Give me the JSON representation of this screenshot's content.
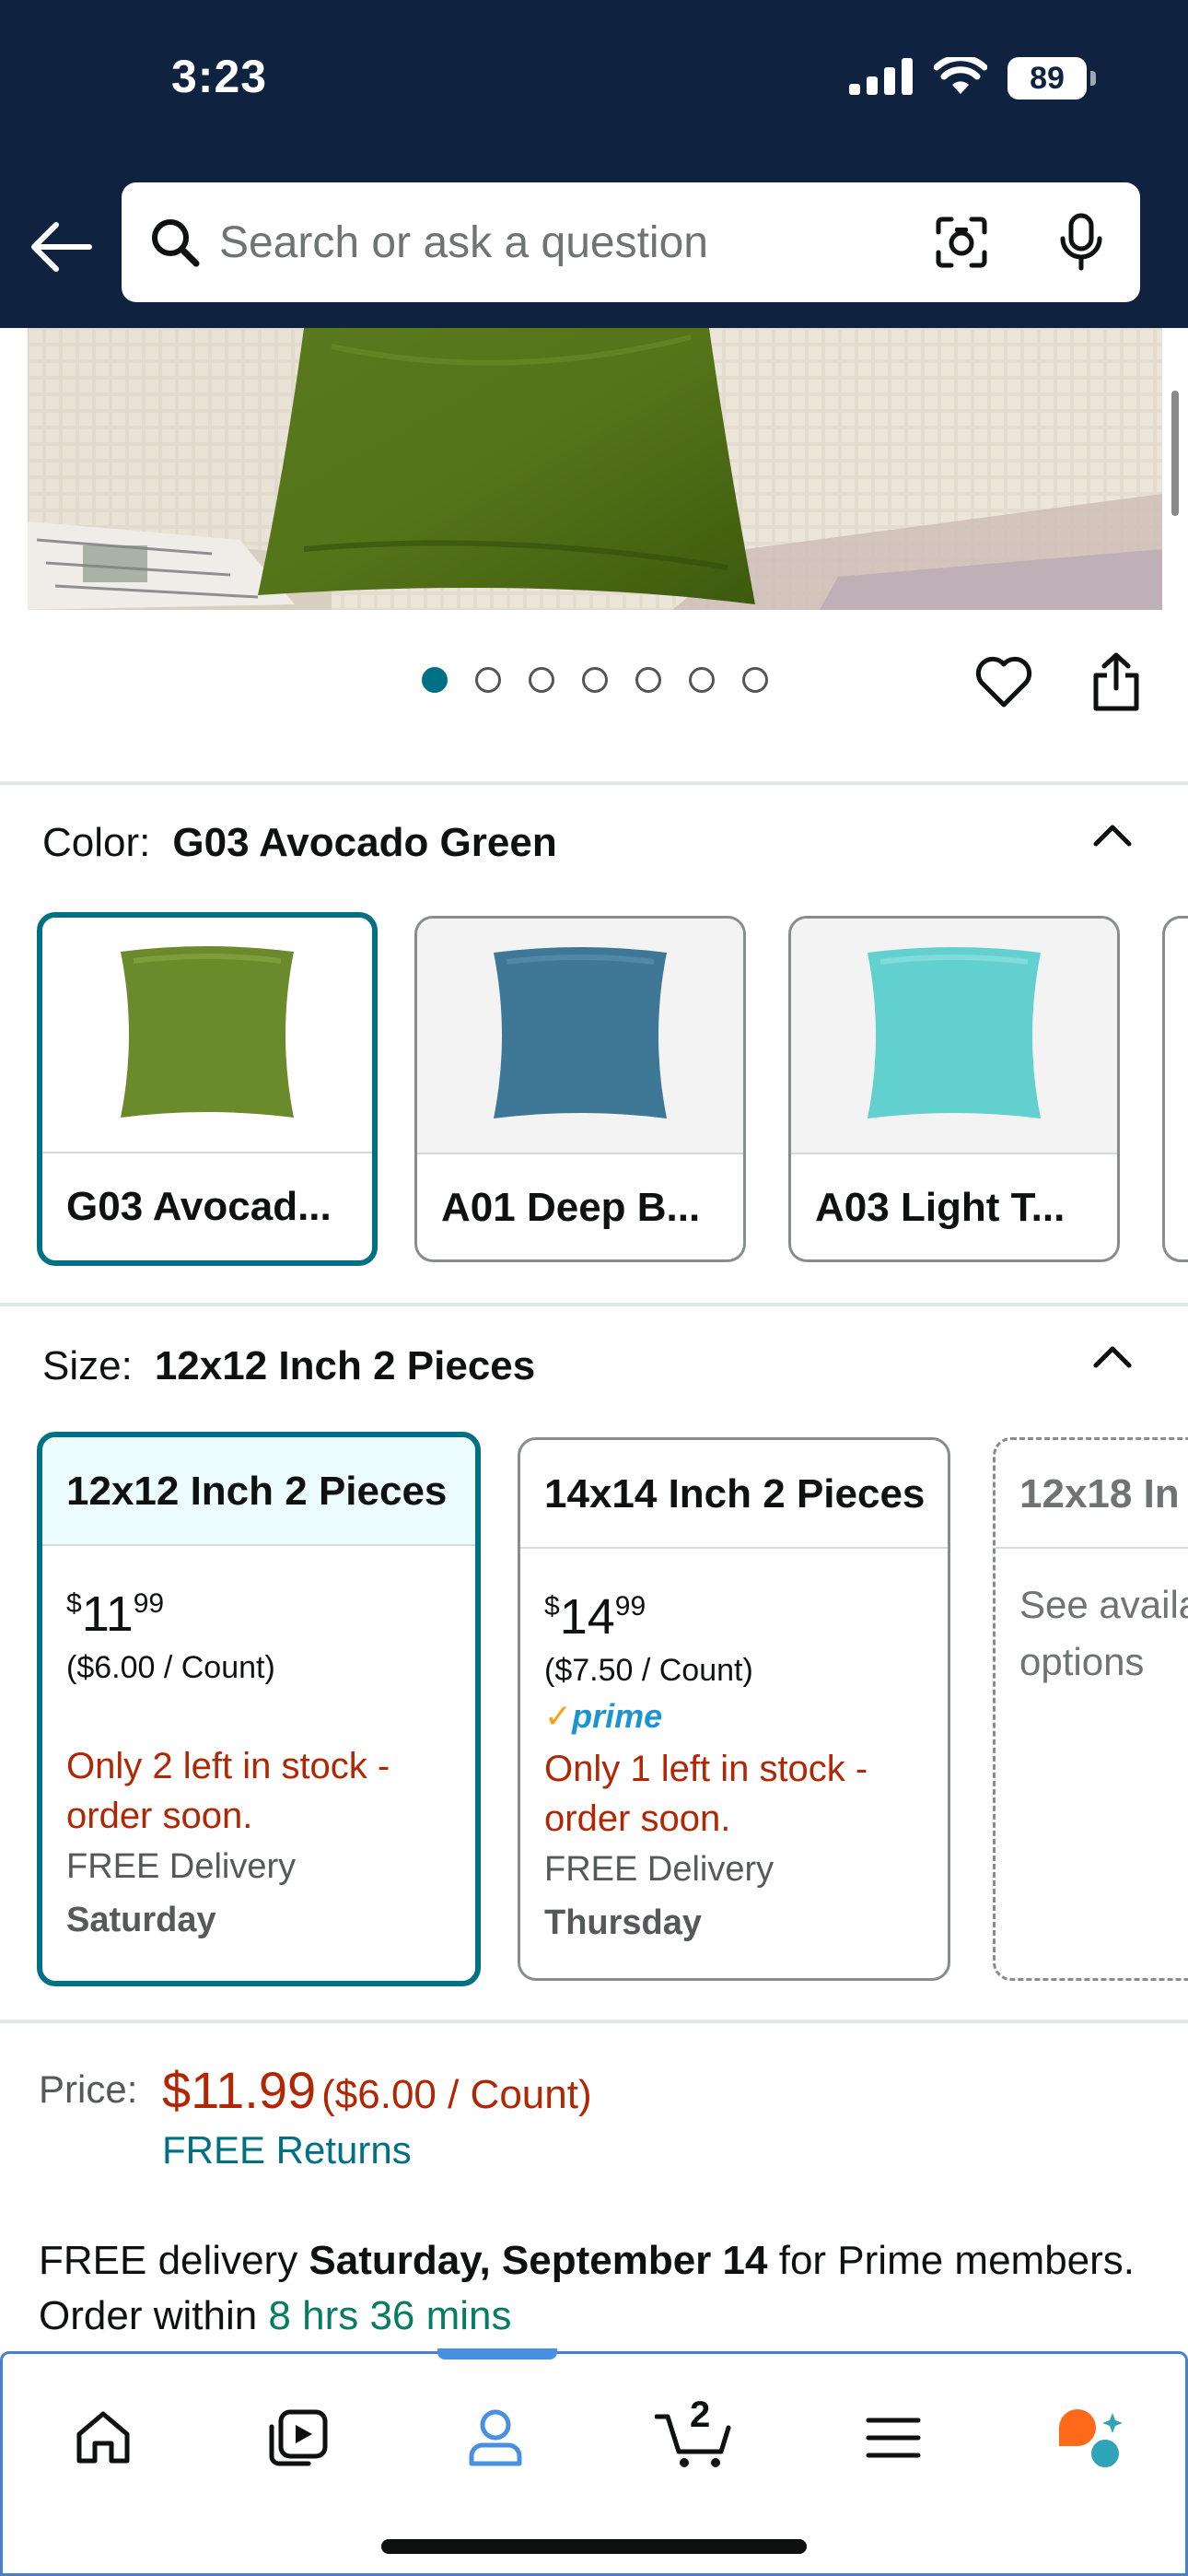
{
  "status_bar": {
    "time": "3:23",
    "battery": "89"
  },
  "search": {
    "placeholder": "Search or ask a question"
  },
  "gallery": {
    "image_count": 7,
    "active_index": 0
  },
  "color": {
    "label": "Color:",
    "selected": "G03 Avocado Green",
    "options": [
      {
        "name": "G03 Avocad...",
        "swatch": "#6b8a2c",
        "selected": true
      },
      {
        "name": "A01 Deep B...",
        "swatch": "#3f7896",
        "selected": false
      },
      {
        "name": "A03 Light T...",
        "swatch": "#62d0cf",
        "selected": false
      }
    ]
  },
  "size": {
    "label": "Size:",
    "selected": "12x12 Inch 2 Pieces",
    "options": [
      {
        "name": "12x12 Inch 2 Pieces",
        "price_symbol": "$",
        "price_whole": "11",
        "price_cents": "99",
        "unit_price": "($6.00 / Count)",
        "prime": false,
        "stock": "Only 2 left in stock - order soon.",
        "delivery": "FREE Delivery",
        "delivery_day": "Saturday",
        "selected": true
      },
      {
        "name": "14x14 Inch 2 Pieces",
        "price_symbol": "$",
        "price_whole": "14",
        "price_cents": "99",
        "unit_price": "($7.50 / Count)",
        "prime": true,
        "prime_label": "prime",
        "stock": "Only 1 left in stock - order soon.",
        "delivery": "FREE Delivery",
        "delivery_day": "Thursday",
        "selected": false
      },
      {
        "name": "12x18 In",
        "availability": "See availa options",
        "availability_lines": [
          "See availa",
          "options"
        ],
        "selected": false
      }
    ]
  },
  "price": {
    "label": "Price:",
    "amount": "$11.99",
    "unit_price": "($6.00 / Count)",
    "returns": "FREE Returns"
  },
  "delivery_info": {
    "prefix": "FREE delivery",
    "date": "Saturday, September 14",
    "middle": "for Prime members. Order within",
    "countdown": "8 hrs 36 mins"
  },
  "bottom_nav": {
    "items": [
      "home",
      "video",
      "account",
      "cart",
      "menu",
      "rufus"
    ],
    "active": "account",
    "cart_count": "2"
  },
  "colors": {
    "header_bg": "#0f2341",
    "accent_teal": "#007185",
    "price_red": "#b12704",
    "link_teal": "#007185",
    "countdown_green": "#067d62",
    "nav_active": "#4a90e2"
  }
}
